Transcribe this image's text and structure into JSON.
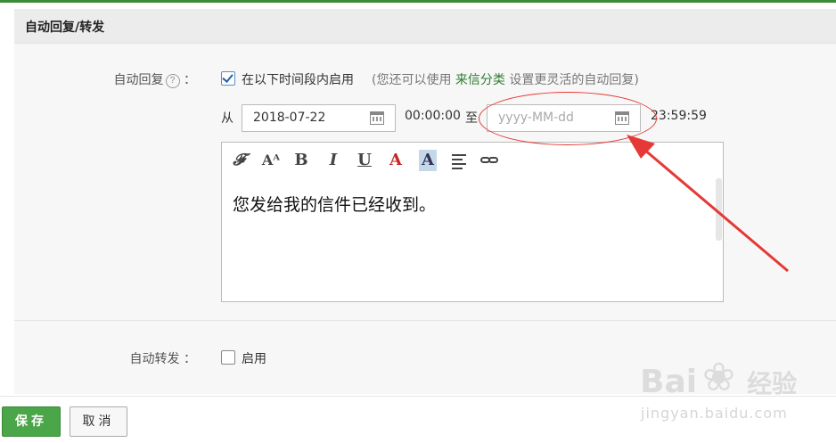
{
  "panel": {
    "title": "自动回复/转发"
  },
  "auto_reply": {
    "label": "自动回复",
    "help_glyph": "?",
    "colon": "：",
    "enabled": true,
    "enable_text": "在以下时间段内启用",
    "hint_prefix": "(您还可以使用",
    "hint_link": "来信分类",
    "hint_suffix": "设置更灵活的自动回复)",
    "from_label": "从",
    "start_date": "2018-07-22",
    "start_time": "00:00:00",
    "to_label": "至",
    "end_date_placeholder": "yyyy-MM-dd",
    "end_time": "23:59:59",
    "message": "您发给我的信件已经收到。"
  },
  "toolbar": {
    "font_icon": "𝓕",
    "size_icon": "Aᴬ",
    "bold": "B",
    "italic": "I",
    "underline": "U",
    "font_color": "A",
    "bg_color": "A"
  },
  "auto_forward": {
    "label": "自动转发",
    "colon": "：",
    "enabled": false,
    "enable_text": "启用"
  },
  "actions": {
    "save": "保存",
    "cancel": "取消"
  },
  "watermark": {
    "logo_text": "Bai",
    "logo_text2": "经验",
    "paw": "❀",
    "url": "jingyan.baidu.com"
  },
  "colors": {
    "accent_green": "#4aa648",
    "annotation_red": "#e53935"
  }
}
